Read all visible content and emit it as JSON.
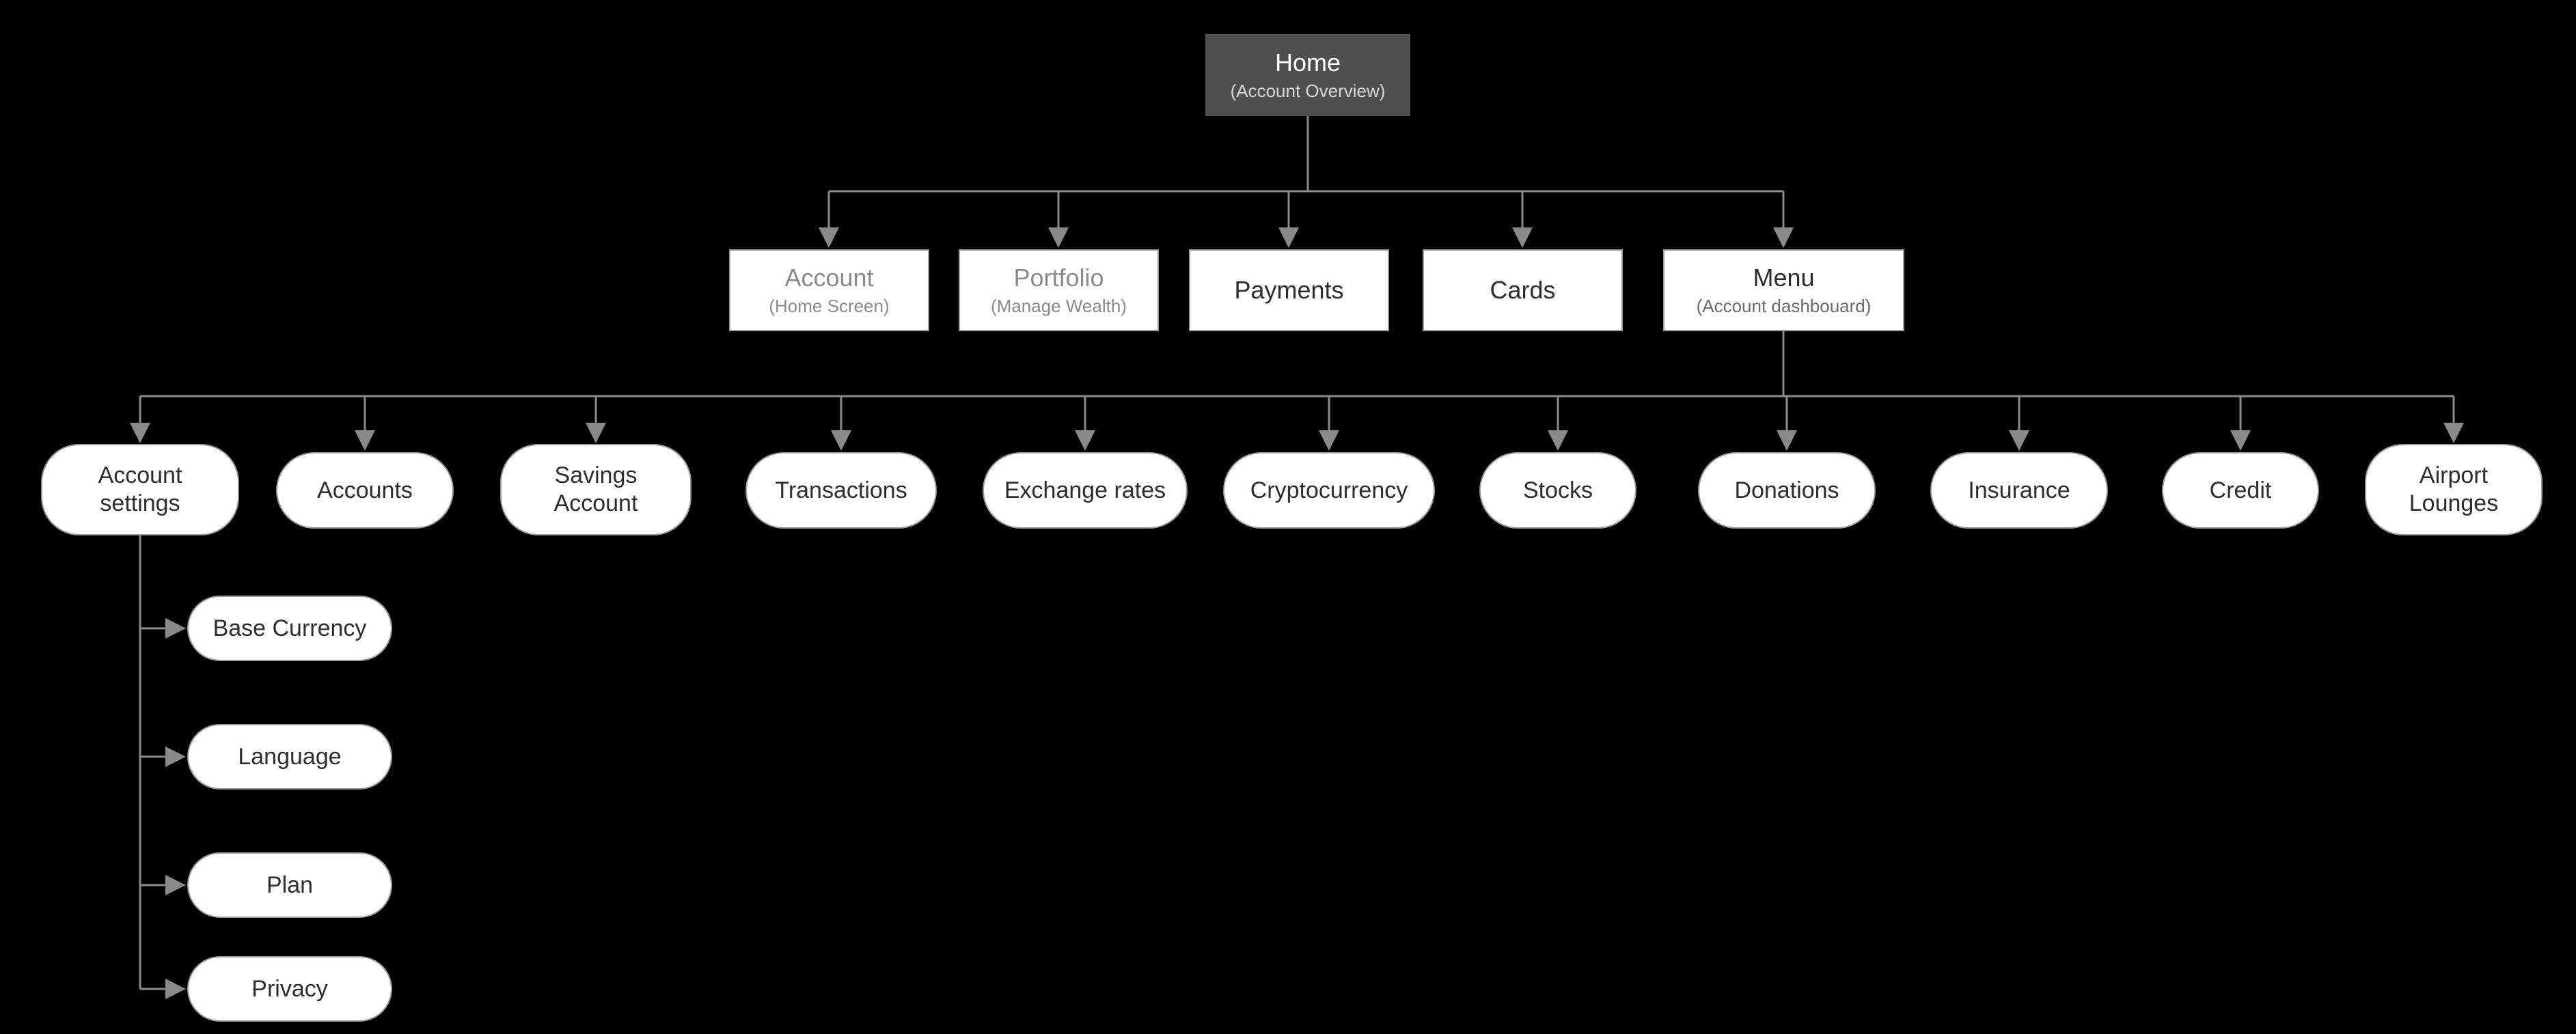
{
  "root": {
    "title": "Home",
    "subtitle": "(Account Overview)"
  },
  "level2": {
    "account": {
      "title": "Account",
      "subtitle": "(Home Screen)"
    },
    "portfolio": {
      "title": "Portfolio",
      "subtitle": "(Manage Wealth)"
    },
    "payments": {
      "title": "Payments"
    },
    "cards": {
      "title": "Cards"
    },
    "menu": {
      "title": "Menu",
      "subtitle": "(Account dashbouard)"
    }
  },
  "menuItems": {
    "acctset": {
      "title": "Account settings"
    },
    "accounts": {
      "title": "Accounts"
    },
    "savings": {
      "title": "Savings Account"
    },
    "trans": {
      "title": "Transactions"
    },
    "exchange": {
      "title": "Exchange rates"
    },
    "crypto": {
      "title": "Cryptocurrency"
    },
    "stocks": {
      "title": "Stocks"
    },
    "donations": {
      "title": "Donations"
    },
    "insurance": {
      "title": "Insurance"
    },
    "credit": {
      "title": "Credit"
    },
    "airport": {
      "title": "Airport Lounges"
    }
  },
  "settingsItems": {
    "basecur": {
      "title": "Base Currency"
    },
    "language": {
      "title": "Language"
    },
    "plan": {
      "title": "Plan"
    },
    "privacy": {
      "title": "Privacy"
    }
  }
}
